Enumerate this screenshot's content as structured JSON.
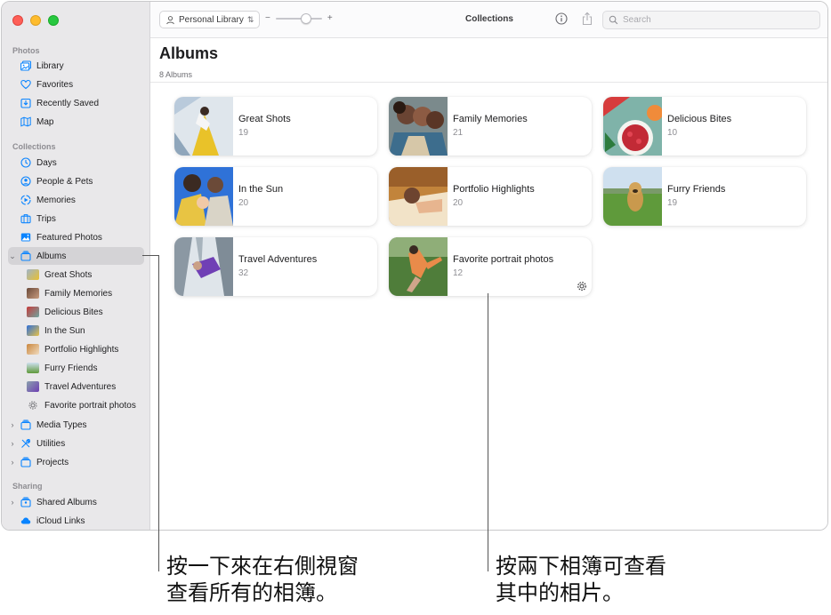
{
  "sidebar": {
    "sections": {
      "photos": "Photos",
      "collections": "Collections",
      "sharing": "Sharing"
    },
    "photos_items": [
      "Library",
      "Favorites",
      "Recently Saved",
      "Map"
    ],
    "collections_items": [
      "Days",
      "People & Pets",
      "Memories",
      "Trips",
      "Featured Photos"
    ],
    "albums_label": "Albums",
    "album_items": [
      "Great Shots",
      "Family Memories",
      "Delicious Bites",
      "In the Sun",
      "Portfolio Highlights",
      "Furry Friends",
      "Travel Adventures",
      "Favorite portrait photos"
    ],
    "more_items": [
      "Media Types",
      "Utilities",
      "Projects"
    ],
    "sharing_items": [
      "Shared Albums",
      "iCloud Links"
    ]
  },
  "toolbar": {
    "library_label": "Personal Library",
    "zoom_minus": "−",
    "zoom_plus": "+",
    "title": "Collections",
    "search_placeholder": "Search"
  },
  "content": {
    "title": "Albums",
    "subtitle": "8 Albums",
    "albums": [
      {
        "name": "Great Shots",
        "count": "19"
      },
      {
        "name": "Family Memories",
        "count": "21"
      },
      {
        "name": "Delicious Bites",
        "count": "10"
      },
      {
        "name": "In the Sun",
        "count": "20"
      },
      {
        "name": "Portfolio Highlights",
        "count": "20"
      },
      {
        "name": "Furry Friends",
        "count": "19"
      },
      {
        "name": "Travel Adventures",
        "count": "32"
      },
      {
        "name": "Favorite portrait photos",
        "count": "12"
      }
    ]
  },
  "callouts": {
    "left_line1": "按一下來在右側視窗",
    "left_line2": "查看所有的相簿。",
    "right_line1": "按兩下相簿可查看",
    "right_line2": "其中的相片。"
  },
  "colors": {
    "accent": "#0a84ff",
    "sidebar_bg": "#e9e8ea",
    "selected_bg": "#d4d3d6"
  },
  "icons": {
    "library": "photo-library-icon",
    "favorites": "heart-icon",
    "recently_saved": "download-tray-icon",
    "map": "map-icon",
    "days": "clock-icon",
    "people": "person-icon",
    "memories": "memories-icon",
    "trips": "suitcase-icon",
    "featured": "featured-photos-icon",
    "albums": "album-stack-icon",
    "search": "magnifier-icon",
    "info": "info-icon",
    "share": "share-icon",
    "smart_album": "gear-icon"
  }
}
